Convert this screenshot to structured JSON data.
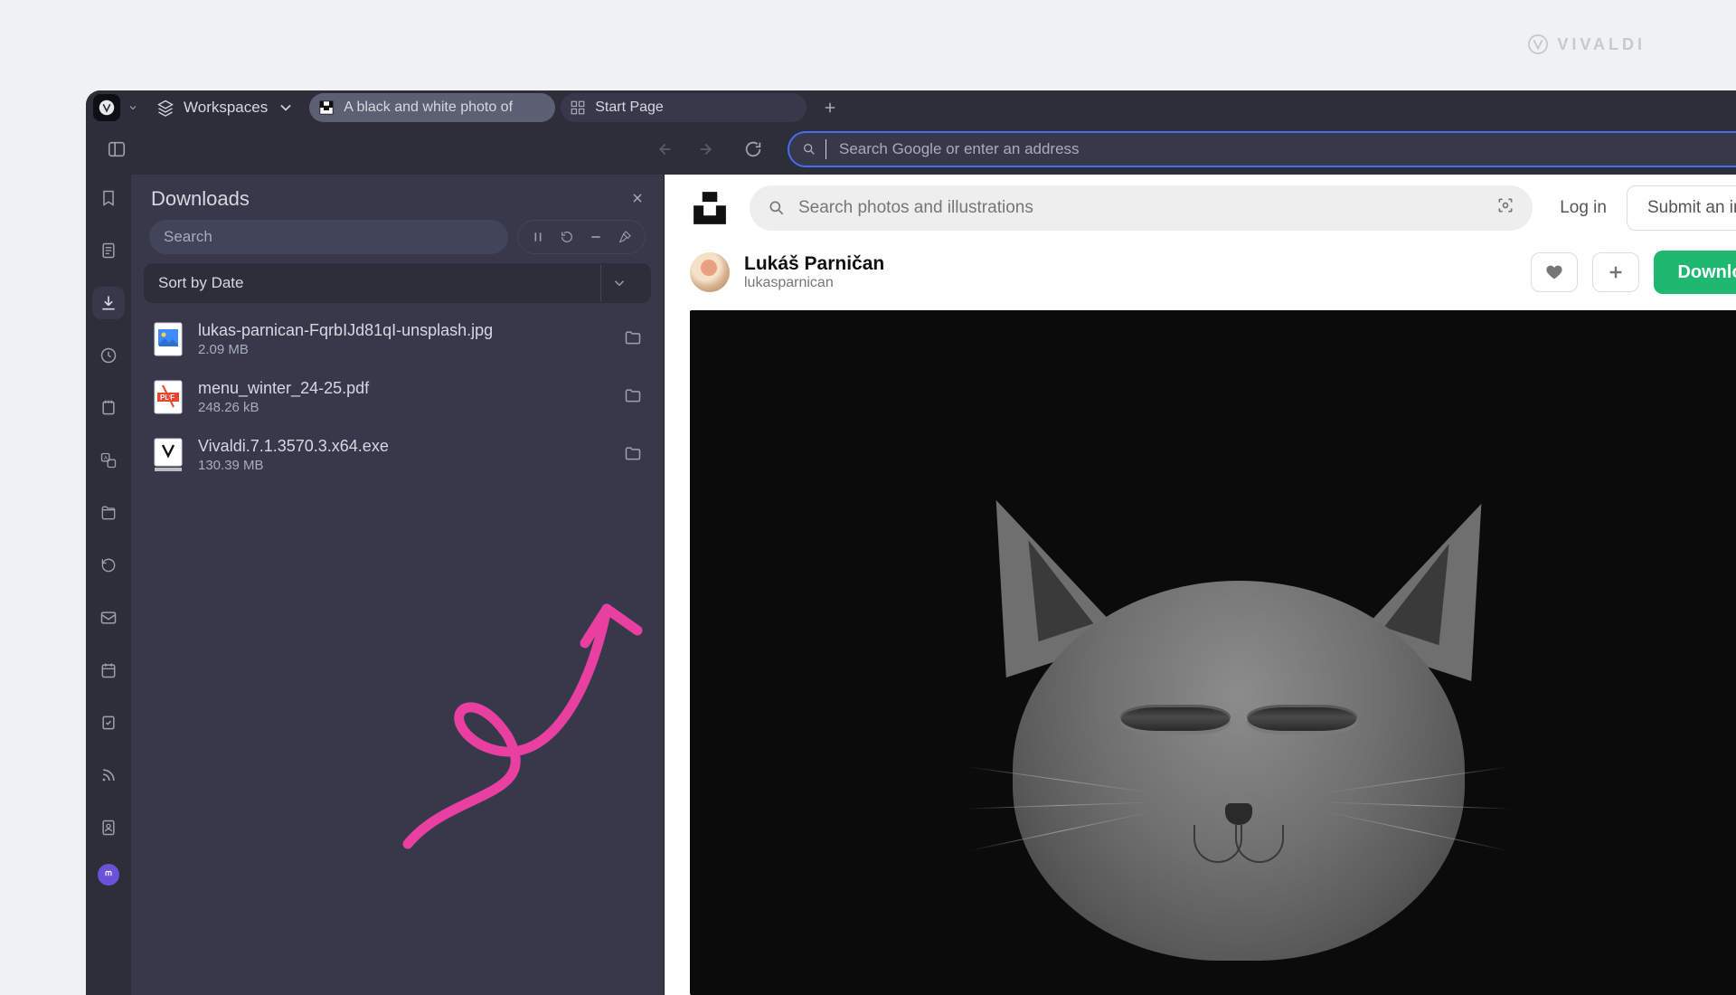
{
  "watermark": "VIVALDI",
  "toolbar": {
    "workspaces_label": "Workspaces",
    "tabs": [
      {
        "label": "A black and white photo of",
        "active": true,
        "icon": "unsplash-favicon"
      },
      {
        "label": "Start Page",
        "active": false,
        "icon": "grid-favicon"
      }
    ]
  },
  "addressbar": {
    "placeholder": "Search Google or enter an address"
  },
  "panel": {
    "title": "Downloads",
    "search_placeholder": "Search",
    "sort_label": "Sort by Date",
    "items": [
      {
        "name": "lukas-parnican-FqrbIJd81qI-unsplash.jpg",
        "size": "2.09 MB",
        "icon": "image-file"
      },
      {
        "name": "menu_winter_24-25.pdf",
        "size": "248.26 kB",
        "icon": "pdf-file"
      },
      {
        "name": "Vivaldi.7.1.3570.3.x64.exe",
        "size": "130.39 MB",
        "icon": "exe-file"
      }
    ]
  },
  "page": {
    "search_placeholder": "Search photos and illustrations",
    "login": "Log in",
    "submit": "Submit an imag",
    "author_name": "Lukáš Parničan",
    "author_username": "lukasparnican",
    "download": "Download"
  }
}
